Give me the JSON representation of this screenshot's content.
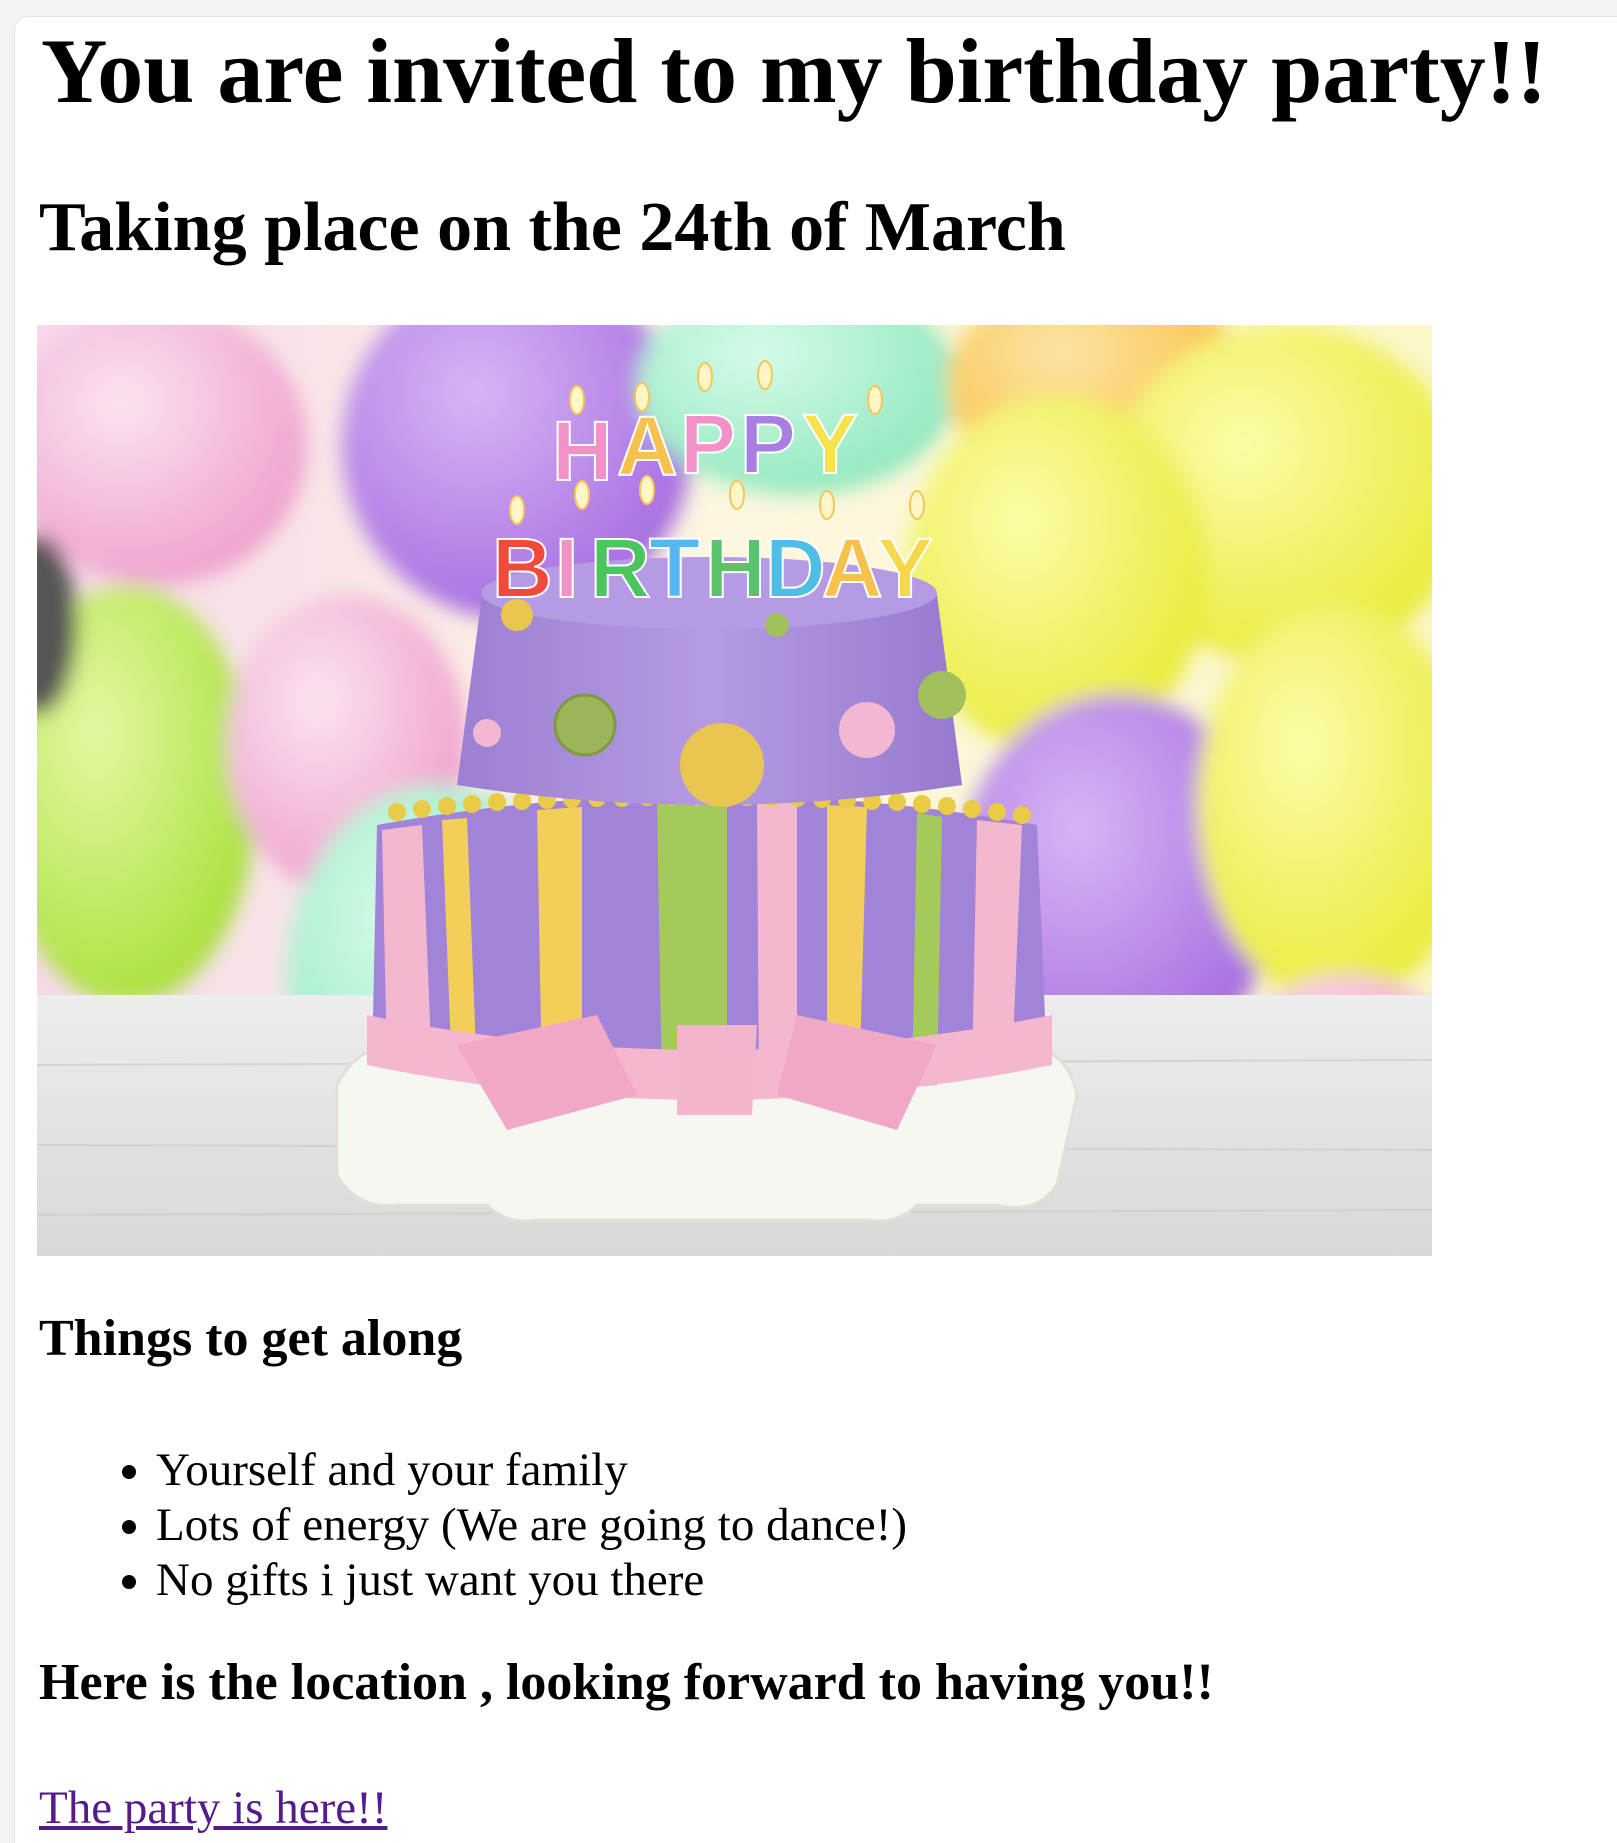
{
  "page": {
    "title": "You are invited to my birthday party!!",
    "subtitle": "Taking place on the 24th of March"
  },
  "image": {
    "candle_top_letters": [
      "H",
      "A",
      "P",
      "P",
      "Y"
    ],
    "candle_bottom_letters": [
      "B",
      "I",
      "R",
      "T",
      "H",
      "D",
      "A",
      "Y"
    ]
  },
  "things": {
    "heading": "Things to get along",
    "items": [
      "Yourself and your family",
      "Lots of energy (We are going to dance!)",
      "No gifts i just want you there"
    ]
  },
  "location": {
    "heading": "Here is the location , looking forward to having you!!",
    "link_text": "The party is here!!"
  },
  "colors": {
    "link_visited": "#551a8b",
    "text": "#000000",
    "background": "#ffffff"
  }
}
